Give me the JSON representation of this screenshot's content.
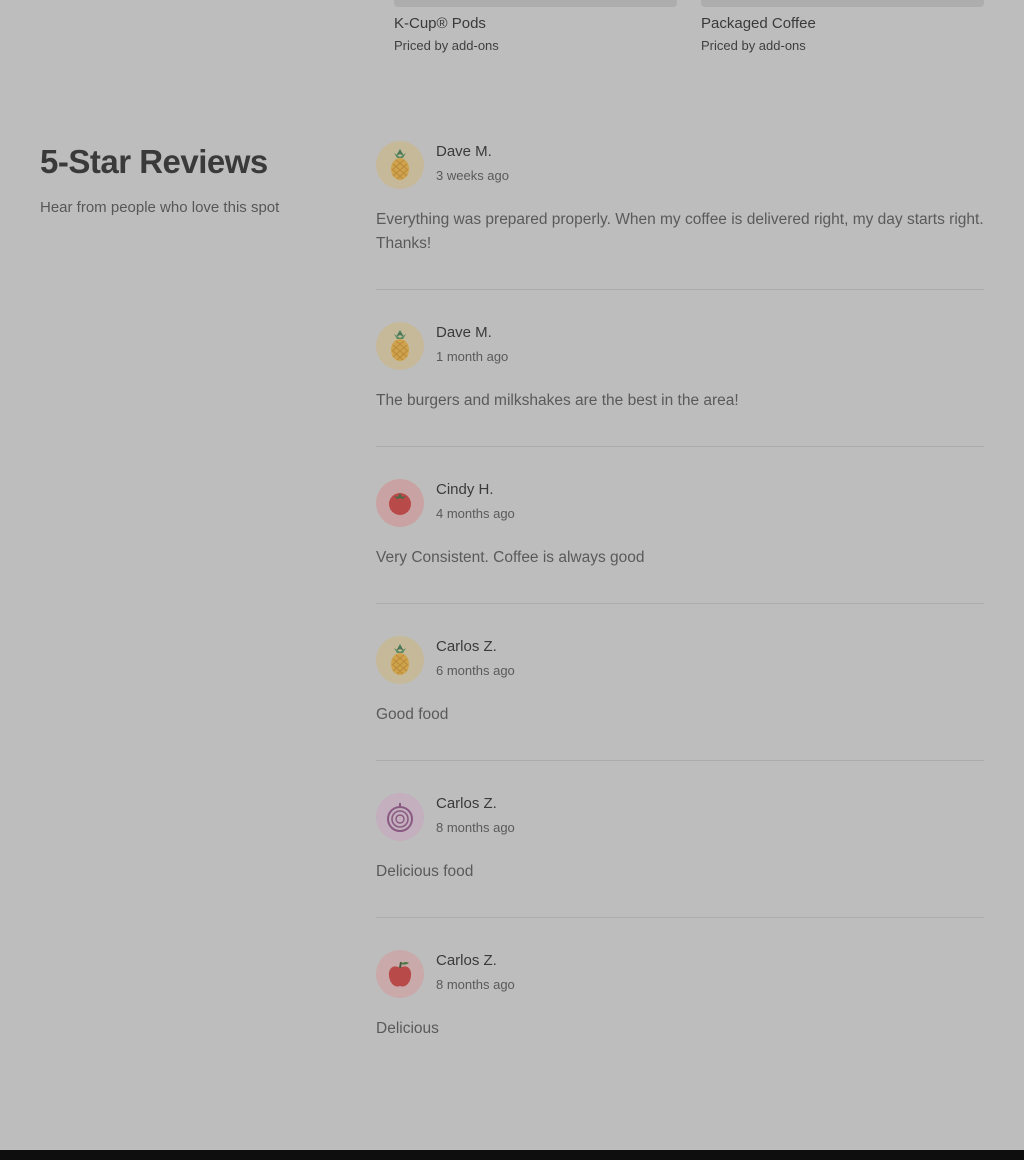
{
  "products": [
    {
      "name": "K-Cup® Pods",
      "meta": "Priced by add-ons"
    },
    {
      "name": "Packaged Coffee",
      "meta": "Priced by add-ons"
    }
  ],
  "reviews_section": {
    "title": "5-Star Reviews",
    "subtitle": "Hear from people who love this spot"
  },
  "reviews": [
    {
      "name": "Dave M.",
      "date": "3 weeks ago",
      "text": "Everything was prepared properly. When my coffee is delivered right, my day starts right. Thanks!",
      "avatar": "pineapple-icon",
      "avatar_bg": "#c6b99a"
    },
    {
      "name": "Dave M.",
      "date": "1 month ago",
      "text": "The burgers and milkshakes are the best in the area!",
      "avatar": "pineapple-icon",
      "avatar_bg": "#c6b99a"
    },
    {
      "name": "Cindy H.",
      "date": "4 months ago",
      "text": "Very Consistent. Coffee is always good",
      "avatar": "tomato-icon",
      "avatar_bg": "#c9a3a3"
    },
    {
      "name": "Carlos Z.",
      "date": "6 months ago",
      "text": "Good food",
      "avatar": "pineapple-icon",
      "avatar_bg": "#c6b99a"
    },
    {
      "name": "Carlos Z.",
      "date": "8 months ago",
      "text": "Delicious food",
      "avatar": "onion-icon",
      "avatar_bg": "#c3afbd"
    },
    {
      "name": "Carlos Z.",
      "date": "8 months ago",
      "text": "Delicious",
      "avatar": "apple-icon",
      "avatar_bg": "#c9a9aa"
    }
  ]
}
